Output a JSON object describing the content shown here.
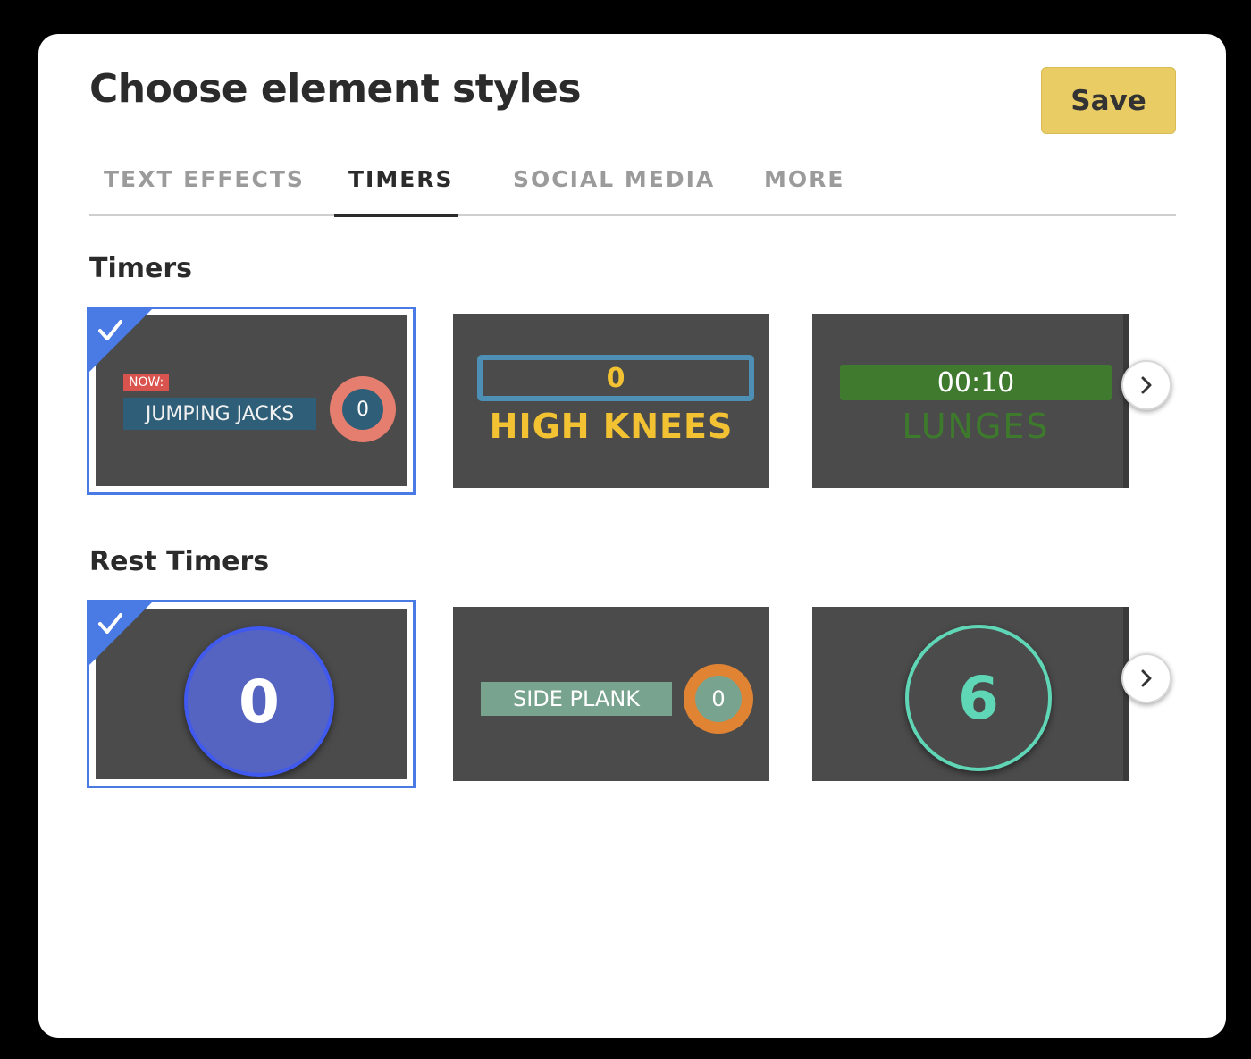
{
  "dialog": {
    "title": "Choose element styles",
    "save_label": "Save"
  },
  "tabs": [
    {
      "label": "TEXT EFFECTS",
      "active": false
    },
    {
      "label": "TIMERS",
      "active": true
    },
    {
      "label": "SOCIAL MEDIA",
      "active": false
    },
    {
      "label": "MORE",
      "active": false
    }
  ],
  "sections": {
    "timers": {
      "title": "Timers",
      "cards": [
        {
          "style": "now-badge",
          "badge": "NOW:",
          "exercise": "JUMPING JACKS",
          "count": "0",
          "selected": true
        },
        {
          "style": "bar-top",
          "count": "0",
          "exercise": "HIGH KNEES",
          "selected": false
        },
        {
          "style": "green-bar",
          "time": "00:10",
          "exercise": "LUNGES",
          "selected": false
        }
      ]
    },
    "rest_timers": {
      "title": "Rest Timers",
      "cards": [
        {
          "style": "big-circle",
          "count": "0",
          "selected": true
        },
        {
          "style": "plank-bar",
          "exercise": "SIDE PLANK",
          "count": "0",
          "selected": false
        },
        {
          "style": "ring",
          "count": "6",
          "selected": false
        }
      ]
    }
  },
  "colors": {
    "accent": "#4a7ae3",
    "save": "#e9cc63",
    "card_bg": "#4b4b4b"
  },
  "icons": {
    "check": "check-icon",
    "next": "chevron-right-icon"
  }
}
